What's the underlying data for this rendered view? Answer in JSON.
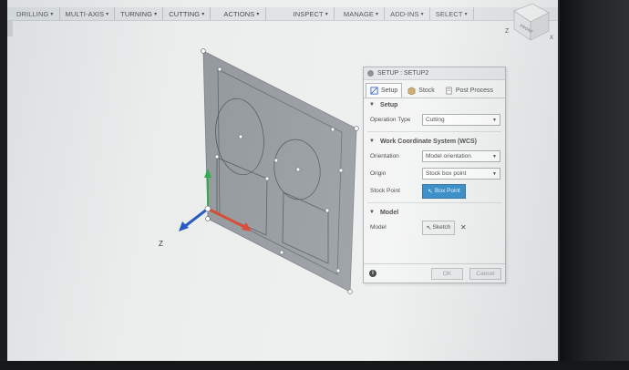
{
  "toolbar": {
    "items": [
      {
        "label": "DRILLING",
        "caret": "▾"
      },
      {
        "label": "MULTI-AXIS",
        "caret": "▾"
      },
      {
        "label": "TURNING",
        "caret": "▾"
      },
      {
        "label": "CUTTING",
        "caret": "▾"
      },
      {
        "label": "ACTIONS",
        "caret": "▾"
      },
      {
        "label": "INSPECT",
        "caret": "▾"
      },
      {
        "label": "MANAGE",
        "caret": "▾"
      },
      {
        "label": "ADD-INS",
        "caret": "▾"
      },
      {
        "label": "SELECT",
        "caret": "▾"
      }
    ]
  },
  "viewcube": {
    "front": "FRONT",
    "axis_z": "Z",
    "axis_x": "X"
  },
  "triad": {
    "z_label": "Z"
  },
  "dialog": {
    "title": "SETUP : SETUP2",
    "tabs": [
      {
        "label": "Setup",
        "icon": "setup-icon"
      },
      {
        "label": "Stock",
        "icon": "stock-icon"
      },
      {
        "label": "Post Process",
        "icon": "post-process-icon"
      }
    ],
    "setup_section": {
      "heading": "Setup",
      "operation_type_label": "Operation Type",
      "operation_type_value": "Cutting"
    },
    "wcs_section": {
      "heading": "Work Coordinate System (WCS)",
      "orientation_label": "Orientation",
      "orientation_value": "Model orientation",
      "origin_label": "Origin",
      "origin_value": "Stock box point",
      "stock_point_label": "Stock Point",
      "stock_point_button": "Box Point"
    },
    "model_section": {
      "heading": "Model",
      "model_label": "Model",
      "sketch_button": "Sketch",
      "clear_symbol": "✕"
    },
    "footer": {
      "info": "i",
      "ok": "OK",
      "cancel": "Cancel"
    }
  },
  "colors": {
    "accent_blue": "#1d7fc4",
    "plate": "#8e9498",
    "axis_green": "#2fa84a",
    "axis_red": "#d9442e",
    "axis_blue": "#2457c4"
  }
}
